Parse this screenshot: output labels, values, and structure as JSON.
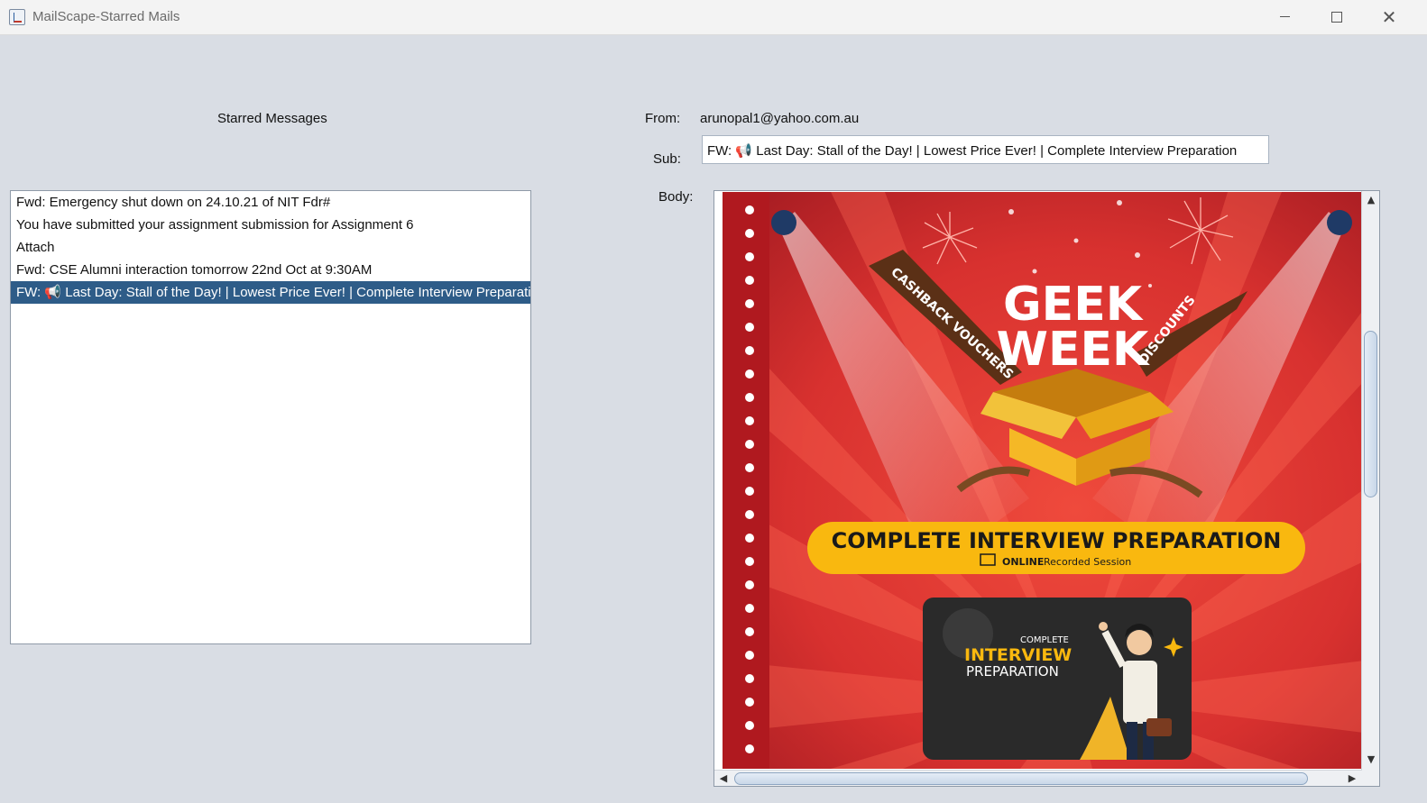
{
  "window": {
    "title": "MailScape-Starred Mails",
    "controls": {
      "minimize": "minimize",
      "maximize": "maximize",
      "close": "✕"
    }
  },
  "labels": {
    "starred_heading": "Starred Messages",
    "from": "From:",
    "sub": "Sub:",
    "body": "Body:"
  },
  "message": {
    "from_value": "arunopal1@yahoo.com.au",
    "subject_value": "FW: 📢 Last Day: Stall of the Day! | Lowest Price Ever! | Complete Interview Preparation"
  },
  "starred_list": {
    "items": [
      {
        "label": "Fwd: Emergency shut down on 24.10.21 of NIT Fdr#",
        "selected": false
      },
      {
        "label": "You have submitted your assignment submission for Assignment 6",
        "selected": false
      },
      {
        "label": "Attach",
        "selected": false
      },
      {
        "label": "Fwd: CSE Alumni interaction tomorrow 22nd Oct at 9:30AM",
        "selected": false
      },
      {
        "label": "FW: 📢 Last Day: Stall of the Day! | Lowest Price Ever! | Complete Interview Preparation",
        "selected": true
      }
    ]
  },
  "email_image": {
    "geek": "GEEK",
    "week": "WEEK",
    "ribbon_left": "CASHBACK VOUCHERS",
    "ribbon_right": "DISCOUNTS",
    "banner_title": "COMPLETE INTERVIEW PREPARATION",
    "banner_sub_bold": "ONLINE",
    "banner_sub": "Recorded Session",
    "card_complete": "COMPLETE",
    "card_interview": "INTERVIEW",
    "card_preparation": "PREPARATION",
    "colors": {
      "red": "#c8252b",
      "yellow": "#f9b80f",
      "card": "#2a2a2a",
      "box": "#f5b826"
    }
  }
}
